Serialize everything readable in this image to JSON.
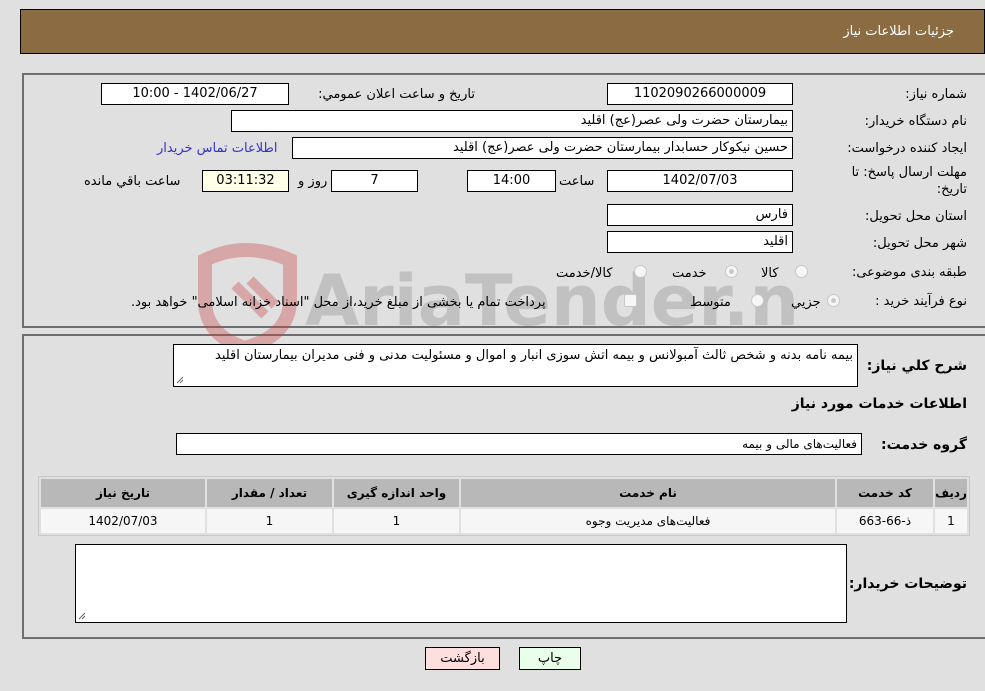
{
  "header": {
    "title": "جزئیات اطلاعات نیاز"
  },
  "form": {
    "need_number": {
      "label": "شماره نیاز:",
      "value": "1102090266000009"
    },
    "announce_datetime": {
      "label": "تاریخ و ساعت اعلان عمومي:",
      "value": "1402/06/27 - 10:00"
    },
    "buyer_org": {
      "label": "نام دستگاه خریدار:",
      "value": "بیمارستان حضرت ولی عصر(عج) اقلید"
    },
    "creator": {
      "label": "ایجاد کننده درخواست:",
      "value": "حسین نیکوکار حسابدار بیمارستان حضرت ولی عصر(عج) اقلید"
    },
    "buyer_contact_link": "اطلاعات تماس خریدار",
    "deadline": {
      "label_line1": "مهلت ارسال پاسخ: تا",
      "label_line2": "تاریخ:",
      "date": "1402/07/03",
      "time_label": "ساعت",
      "time": "14:00",
      "days": "7",
      "days_label": "روز و",
      "remaining": "03:11:32",
      "remaining_label": "ساعت باقي مانده"
    },
    "province": {
      "label": "استان محل تحویل:",
      "value": "فارس"
    },
    "city": {
      "label": "شهر محل تحویل:",
      "value": "اقلید"
    },
    "category": {
      "label": "طبقه بندی موضوعی:",
      "options": [
        "کالا",
        "خدمت",
        "کالا/خدمت"
      ],
      "selected": "خدمت"
    },
    "purchase_type": {
      "label": "نوع فرآیند خرید :",
      "options": [
        "جزيي",
        "متوسط"
      ],
      "treasury_note": "پرداخت تمام یا بخشی از مبلغ خرید،از محل \"اسناد خزانه اسلامی\" خواهد بود."
    }
  },
  "details": {
    "description_label": "شرح کلي نیاز:",
    "description": "بیمه نامه بدنه و شخص ثالث آمبولانس و بیمه اتش سوزی انبار و اموال و مسئولیت مدنی و فنی مدیران بیمارستان اقلید",
    "services_title": "اطلاعات خدمات مورد نیاز",
    "service_group_label": "گروه خدمت:",
    "service_group": "فعالیت‌های مالی و بیمه",
    "table": {
      "headers": [
        "ردیف",
        "کد خدمت",
        "نام خدمت",
        "واحد اندازه گیری",
        "تعداد / مقدار",
        "تاریخ نیاز"
      ],
      "rows": [
        [
          "1",
          "ذ-66-663",
          "فعالیت‌های مدیریت وجوه",
          "1",
          "1",
          "1402/07/03"
        ]
      ]
    },
    "buyer_notes_label": "توضیحات خریدار:",
    "buyer_notes": ""
  },
  "buttons": {
    "print": "چاپ",
    "back": "بازگشت"
  },
  "watermark_text": "AriaTender.neT"
}
